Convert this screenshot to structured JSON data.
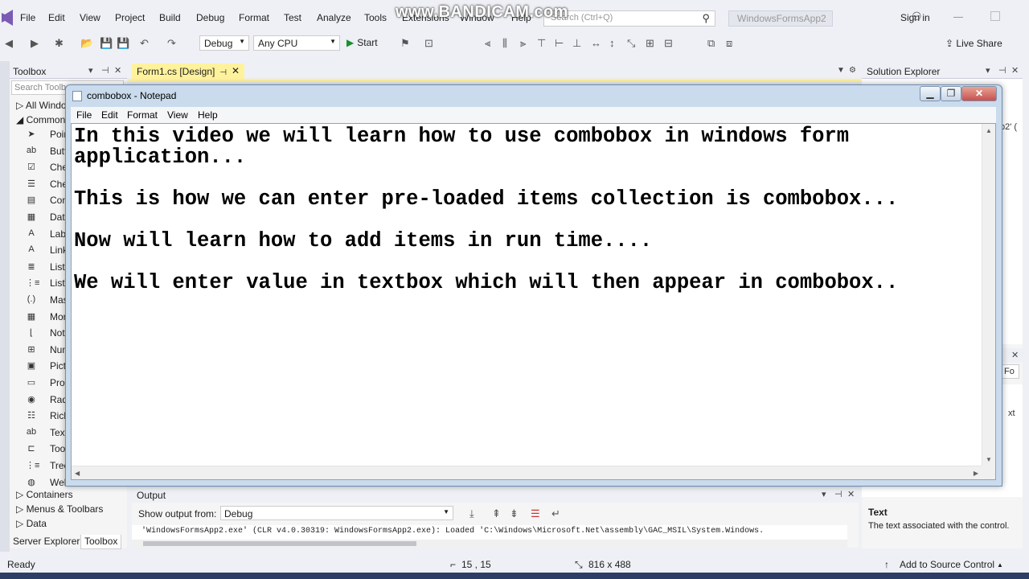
{
  "watermark": "www.BANDICAM.com",
  "vs": {
    "menu": [
      "File",
      "Edit",
      "View",
      "Project",
      "Build",
      "Debug",
      "Format",
      "Test",
      "Analyze",
      "Tools",
      "Extensions",
      "Window",
      "Help"
    ],
    "search_placeholder": "Search (Ctrl+Q)",
    "project_title": "WindowsFormsApp2",
    "sign_in": "Sign in",
    "toolbar": {
      "config": "Debug",
      "platform": "Any CPU",
      "start": "Start",
      "live_share": "Live Share"
    }
  },
  "toolbox": {
    "title": "Toolbox",
    "search_placeholder": "Search Toolbox",
    "groups": [
      "All Windows Forms",
      "Common Controls"
    ],
    "items": [
      {
        "icon": "pointer-icon",
        "glyph": "➤",
        "label": "Pointer"
      },
      {
        "icon": "button-icon",
        "glyph": "ab",
        "label": "Button"
      },
      {
        "icon": "checkbox-icon",
        "glyph": "☑",
        "label": "CheckBox"
      },
      {
        "icon": "checkedlistbox-icon",
        "glyph": "☰",
        "label": "CheckedListBox"
      },
      {
        "icon": "combobox-icon",
        "glyph": "▤",
        "label": "ComboBox"
      },
      {
        "icon": "datetimepicker-icon",
        "glyph": "▦",
        "label": "DateTimePicker"
      },
      {
        "icon": "label-icon",
        "glyph": "A",
        "label": "Label"
      },
      {
        "icon": "linklabel-icon",
        "glyph": "A",
        "label": "LinkLabel"
      },
      {
        "icon": "listbox-icon",
        "glyph": "≣",
        "label": "ListBox"
      },
      {
        "icon": "listview-icon",
        "glyph": "⋮≡",
        "label": "ListView"
      },
      {
        "icon": "maskedtextbox-icon",
        "glyph": "(.)",
        "label": "MaskedTextBox"
      },
      {
        "icon": "monthcalendar-icon",
        "glyph": "▦",
        "label": "MonthCalendar"
      },
      {
        "icon": "notifyicon-icon",
        "glyph": "⌊",
        "label": "NotifyIcon"
      },
      {
        "icon": "numericupdown-icon",
        "glyph": "⊞",
        "label": "NumericUpDown"
      },
      {
        "icon": "picturebox-icon",
        "glyph": "▣",
        "label": "PictureBox"
      },
      {
        "icon": "progressbar-icon",
        "glyph": "▭",
        "label": "ProgressBar"
      },
      {
        "icon": "radiobutton-icon",
        "glyph": "◉",
        "label": "RadioButton"
      },
      {
        "icon": "richtextbox-icon",
        "glyph": "☷",
        "label": "RichTextBox"
      },
      {
        "icon": "textbox-icon",
        "glyph": "ab",
        "label": "TextBox"
      },
      {
        "icon": "tooltip-icon",
        "glyph": "⊏",
        "label": "ToolTip"
      },
      {
        "icon": "treeview-icon",
        "glyph": "⋮≡",
        "label": "TreeView"
      },
      {
        "icon": "webbrowser-icon",
        "glyph": "◍",
        "label": "WebBrowser"
      }
    ],
    "bottom_groups": [
      "Containers",
      "Menus & Toolbars",
      "Data"
    ],
    "tabs": [
      "Server Explorer",
      "Toolbox"
    ]
  },
  "designer": {
    "tab": "Form1.cs [Design]"
  },
  "solution_explorer": {
    "title": "Solution Explorer",
    "props_partial": [
      "p2' (",
      "Fo",
      "xt"
    ],
    "desc_title": "Text",
    "desc_text": "The text associated with the control."
  },
  "output": {
    "title": "Output",
    "show_from_label": "Show output from:",
    "show_from_value": "Debug",
    "line": "'WindowsFormsApp2.exe' (CLR v4.0.30319: WindowsFormsApp2.exe): Loaded 'C:\\Windows\\Microsoft.Net\\assembly\\GAC_MSIL\\System.Windows."
  },
  "status": {
    "ready": "Ready",
    "position": "15 , 15",
    "size": "816 x 488",
    "source_control": "Add to Source Control"
  },
  "notepad": {
    "title": "combobox - Notepad",
    "menu": [
      "File",
      "Edit",
      "Format",
      "View",
      "Help"
    ],
    "paragraphs": [
      "In this video we will learn how to use combobox in windows form\napplication...",
      "This is how we can enter pre-loaded items collection is combobox...",
      "Now will learn how to add items in run time....",
      "We will enter value in textbox which will then appear in combobox.."
    ]
  },
  "colors": {
    "designer_tab": "#fff29d",
    "notepad_frame": "#c9dbed",
    "close_button": "#c75050"
  }
}
